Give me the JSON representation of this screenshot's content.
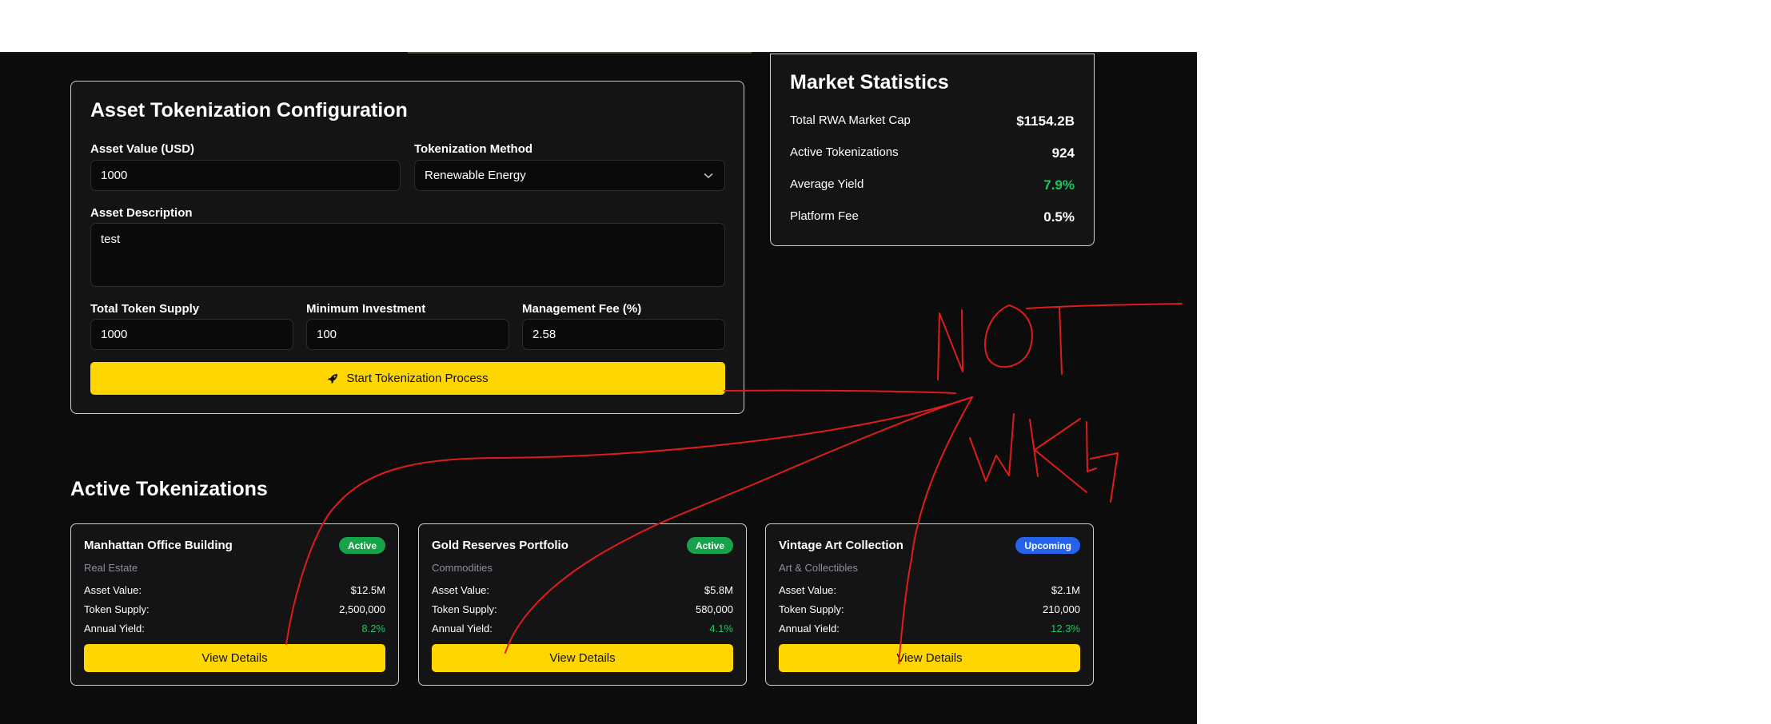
{
  "config": {
    "title": "Asset Tokenization Configuration",
    "asset_value_label": "Asset Value (USD)",
    "asset_value": "1000",
    "method_label": "Tokenization Method",
    "method_value": "Renewable Energy",
    "description_label": "Asset Description",
    "description_value": "test",
    "supply_label": "Total Token Supply",
    "supply_value": "1000",
    "min_invest_label": "Minimum Investment",
    "min_invest_value": "100",
    "fee_label": "Management Fee (%)",
    "fee_value": "2.58",
    "start_button": "Start Tokenization Process"
  },
  "market": {
    "title": "Market Statistics",
    "stats": [
      {
        "label": "Total RWA Market Cap",
        "value": "$1154.2B"
      },
      {
        "label": "Active Tokenizations",
        "value": "924"
      },
      {
        "label": "Average Yield",
        "value": "7.9%"
      },
      {
        "label": "Platform Fee",
        "value": "0.5%"
      }
    ]
  },
  "active": {
    "title": "Active Tokenizations",
    "row_labels": {
      "asset_value": "Asset Value:",
      "token_supply": "Token Supply:",
      "annual_yield": "Annual Yield:"
    },
    "cards": [
      {
        "title": "Manhattan Office Building",
        "category": "Real Estate",
        "status": "Active",
        "asset_value": "$12.5M",
        "token_supply": "2,500,000",
        "annual_yield": "8.2%",
        "button": "View Details"
      },
      {
        "title": "Gold Reserves Portfolio",
        "category": "Commodities",
        "status": "Active",
        "asset_value": "$5.8M",
        "token_supply": "580,000",
        "annual_yield": "4.1%",
        "button": "View Details"
      },
      {
        "title": "Vintage Art Collection",
        "category": "Art & Collectibles",
        "status": "Upcoming",
        "asset_value": "$2.1M",
        "token_supply": "210,000",
        "annual_yield": "12.3%",
        "button": "View Details"
      }
    ]
  },
  "colors": {
    "accent_yellow": "#ffd600",
    "positive_green": "#22c55e",
    "badge_active": "#16a34a",
    "badge_upcoming": "#2563eb",
    "annotation_red": "#e01b1b"
  },
  "icons": {
    "start_button_icon": "rocket-icon",
    "select_caret": "chevron-down-icon"
  },
  "annotation": {
    "text": "NOT WKG"
  }
}
